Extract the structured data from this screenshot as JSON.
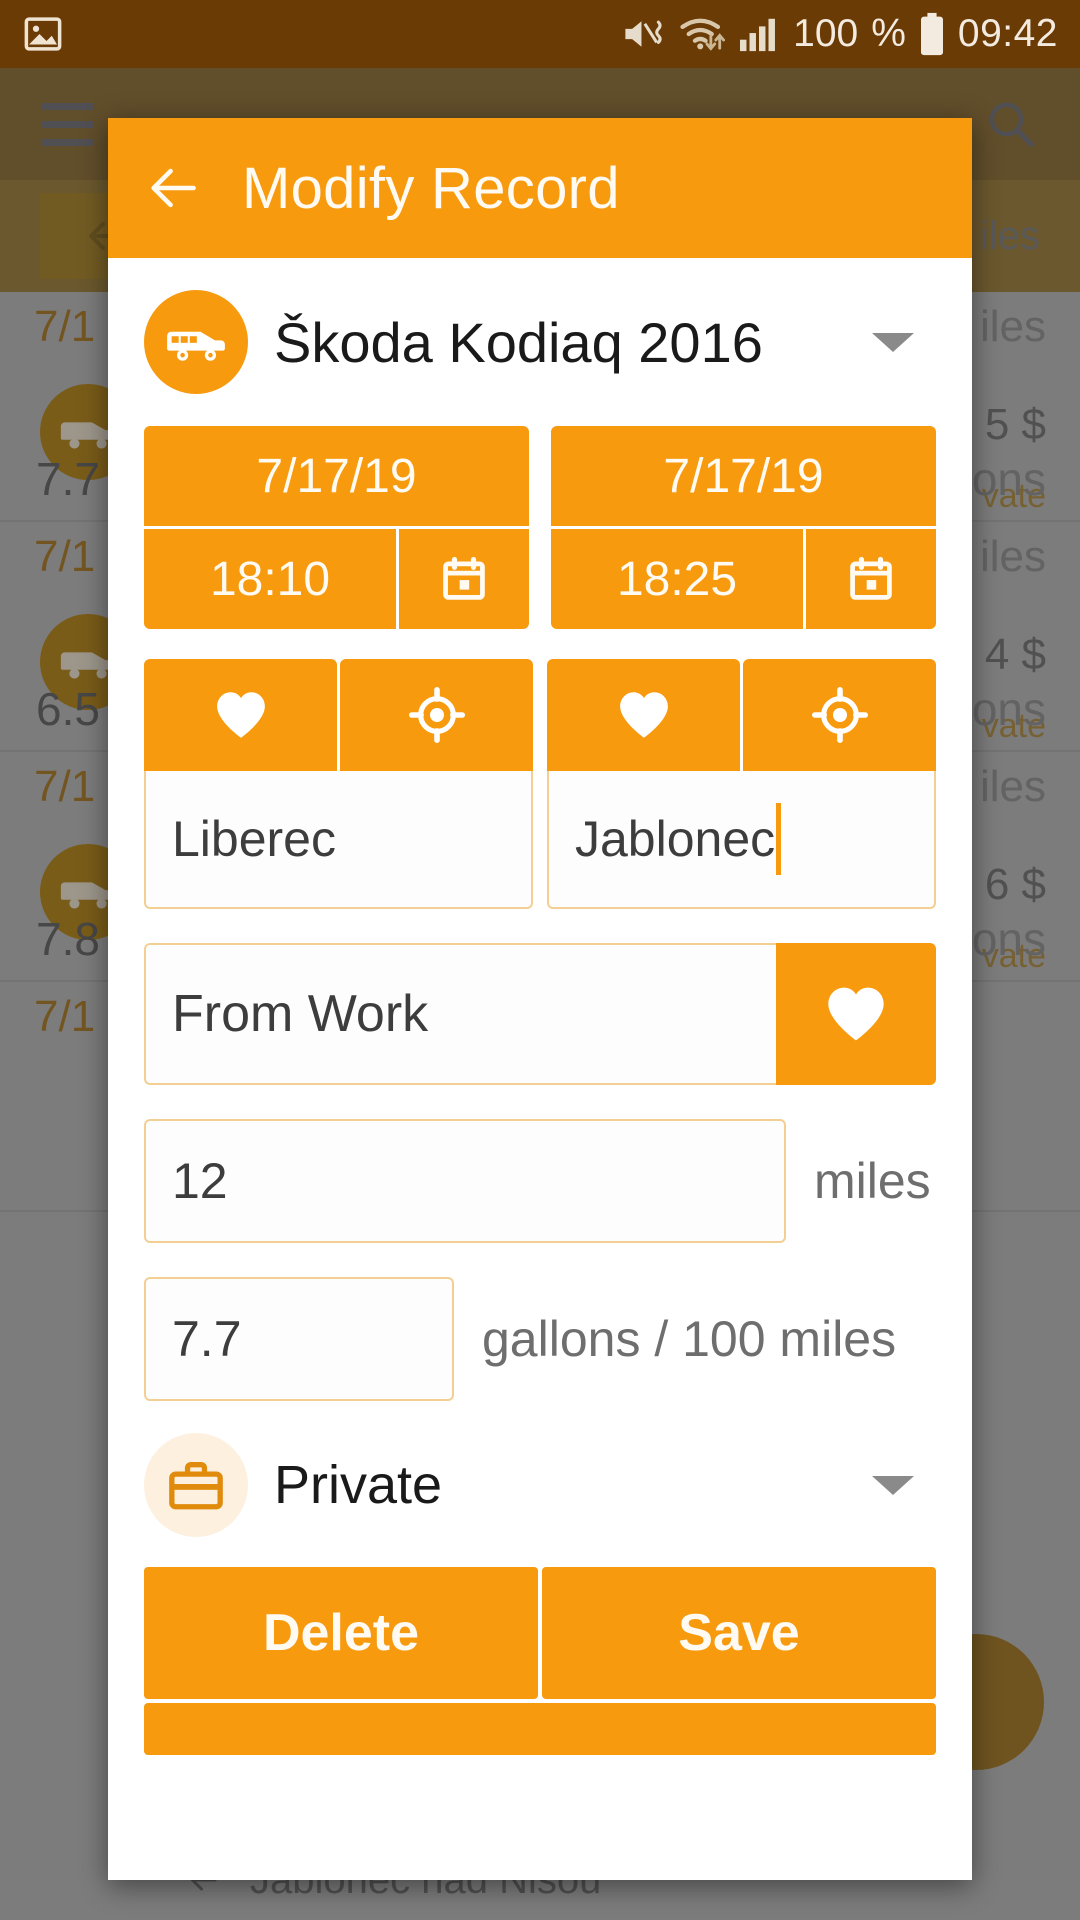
{
  "status_bar": {
    "icons": [
      "image-icon",
      "mute-vibrate-icon",
      "wifi-icon",
      "signal-icon",
      "battery-icon"
    ],
    "battery_percent": "100",
    "clock": "09:42"
  },
  "background_app": {
    "menu_icon": "hamburger-icon",
    "search_icon": "search-icon",
    "back_icon": "back-arrow-icon",
    "bottom_back_label": "Jablonec nad Nisou",
    "rows": [
      {
        "date": "7/1",
        "miles": "iles",
        "cost": "5 $",
        "badge": "vate",
        "consumption": "7.7",
        "gallons": "ons"
      },
      {
        "date": "7/1",
        "miles": "iles",
        "cost": "4 $",
        "badge": "vate",
        "consumption": "6.5",
        "gallons": "ons"
      },
      {
        "date": "7/1",
        "miles": "iles",
        "cost": "6 $",
        "badge": "vate",
        "consumption": "7.8",
        "gallons": "ons"
      },
      {
        "date": "7/1",
        "miles": "",
        "cost": "",
        "badge": "",
        "consumption": "",
        "gallons": ""
      }
    ]
  },
  "dialog": {
    "back_icon": "back-arrow-icon",
    "title": "Modify Record",
    "vehicle": {
      "icon": "car-icon",
      "name": "Škoda Kodiaq 2016",
      "dropdown_icon": "chevron-down-icon"
    },
    "start": {
      "date": "7/17/19",
      "time": "18:10",
      "calendar_icon": "calendar-icon",
      "favourite_icon": "heart-icon",
      "gps_icon": "gps-target-icon",
      "location": "Liberec"
    },
    "end": {
      "date": "7/17/19",
      "time": "18:25",
      "calendar_icon": "calendar-icon",
      "favourite_icon": "heart-icon",
      "gps_icon": "gps-target-icon",
      "location": "Jablonec"
    },
    "purpose": {
      "value": "From Work",
      "favourite_icon": "heart-icon"
    },
    "distance": {
      "value": "12",
      "unit": "miles"
    },
    "consumption": {
      "value": "7.7",
      "unit": "gallons / 100 miles"
    },
    "type": {
      "icon": "briefcase-icon",
      "label": "Private",
      "dropdown_icon": "chevron-down-icon"
    },
    "actions": {
      "delete_label": "Delete",
      "save_label": "Save"
    }
  },
  "colors": {
    "accent": "#f79a0e",
    "appbar_text": "#fffaf2",
    "status_bar_bg": "#6b3b05",
    "field_border": "#f3cf94"
  }
}
